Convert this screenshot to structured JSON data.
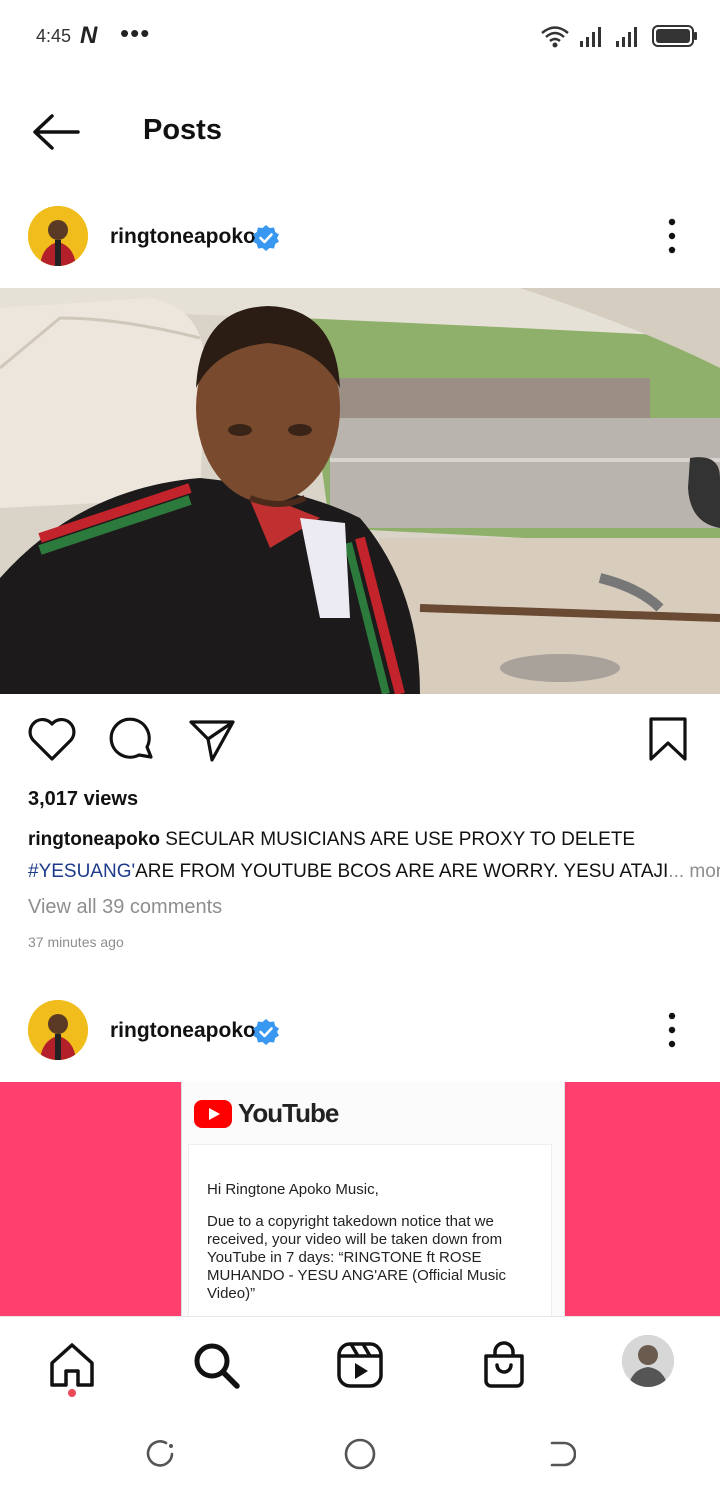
{
  "status_bar": {
    "time": "4:45",
    "app_badge": "N",
    "overflow": "•••"
  },
  "header": {
    "title": "Posts"
  },
  "posts": [
    {
      "username": "ringtoneapoko",
      "verified": true,
      "views": "3,017 views",
      "caption_user": "ringtoneapoko",
      "caption_line1": "SECULAR MUSICIANS ARE USE PROXY TO DELETE",
      "caption_tag": "#YESUANG'",
      "caption_line2": "ARE FROM YOUTUBE BCOS ARE ARE WORRY. YESU ATAJI",
      "caption_more": "... more",
      "comments_link": "View all 39 comments",
      "time_ago": "37 minutes ago"
    },
    {
      "username": "ringtoneapoko",
      "verified": true,
      "image": {
        "brand": "YouTube",
        "greeting": "Hi Ringtone Apoko Music,",
        "body": "Due to a copyright takedown notice that we received, your video will be taken down from YouTube in 7 days: “RINGTONE ft ROSE MUHANDO - YESU ANG'ARE (Official Music Video)”"
      }
    }
  ],
  "colors": {
    "verified": "#3897f0",
    "hashtag": "#1d3b8a",
    "muted": "#8e8e8e",
    "pink_bg": "#ff3f6e",
    "youtube_red": "#ff0000",
    "notification_dot": "#ed4956"
  },
  "icons": {
    "back": "arrow-left-icon",
    "like": "heart-icon",
    "comment": "comment-bubble-icon",
    "share": "paper-plane-icon",
    "save": "bookmark-icon",
    "home": "home-icon",
    "search": "search-icon",
    "reels": "reels-icon",
    "shop": "shopping-bag-icon"
  }
}
